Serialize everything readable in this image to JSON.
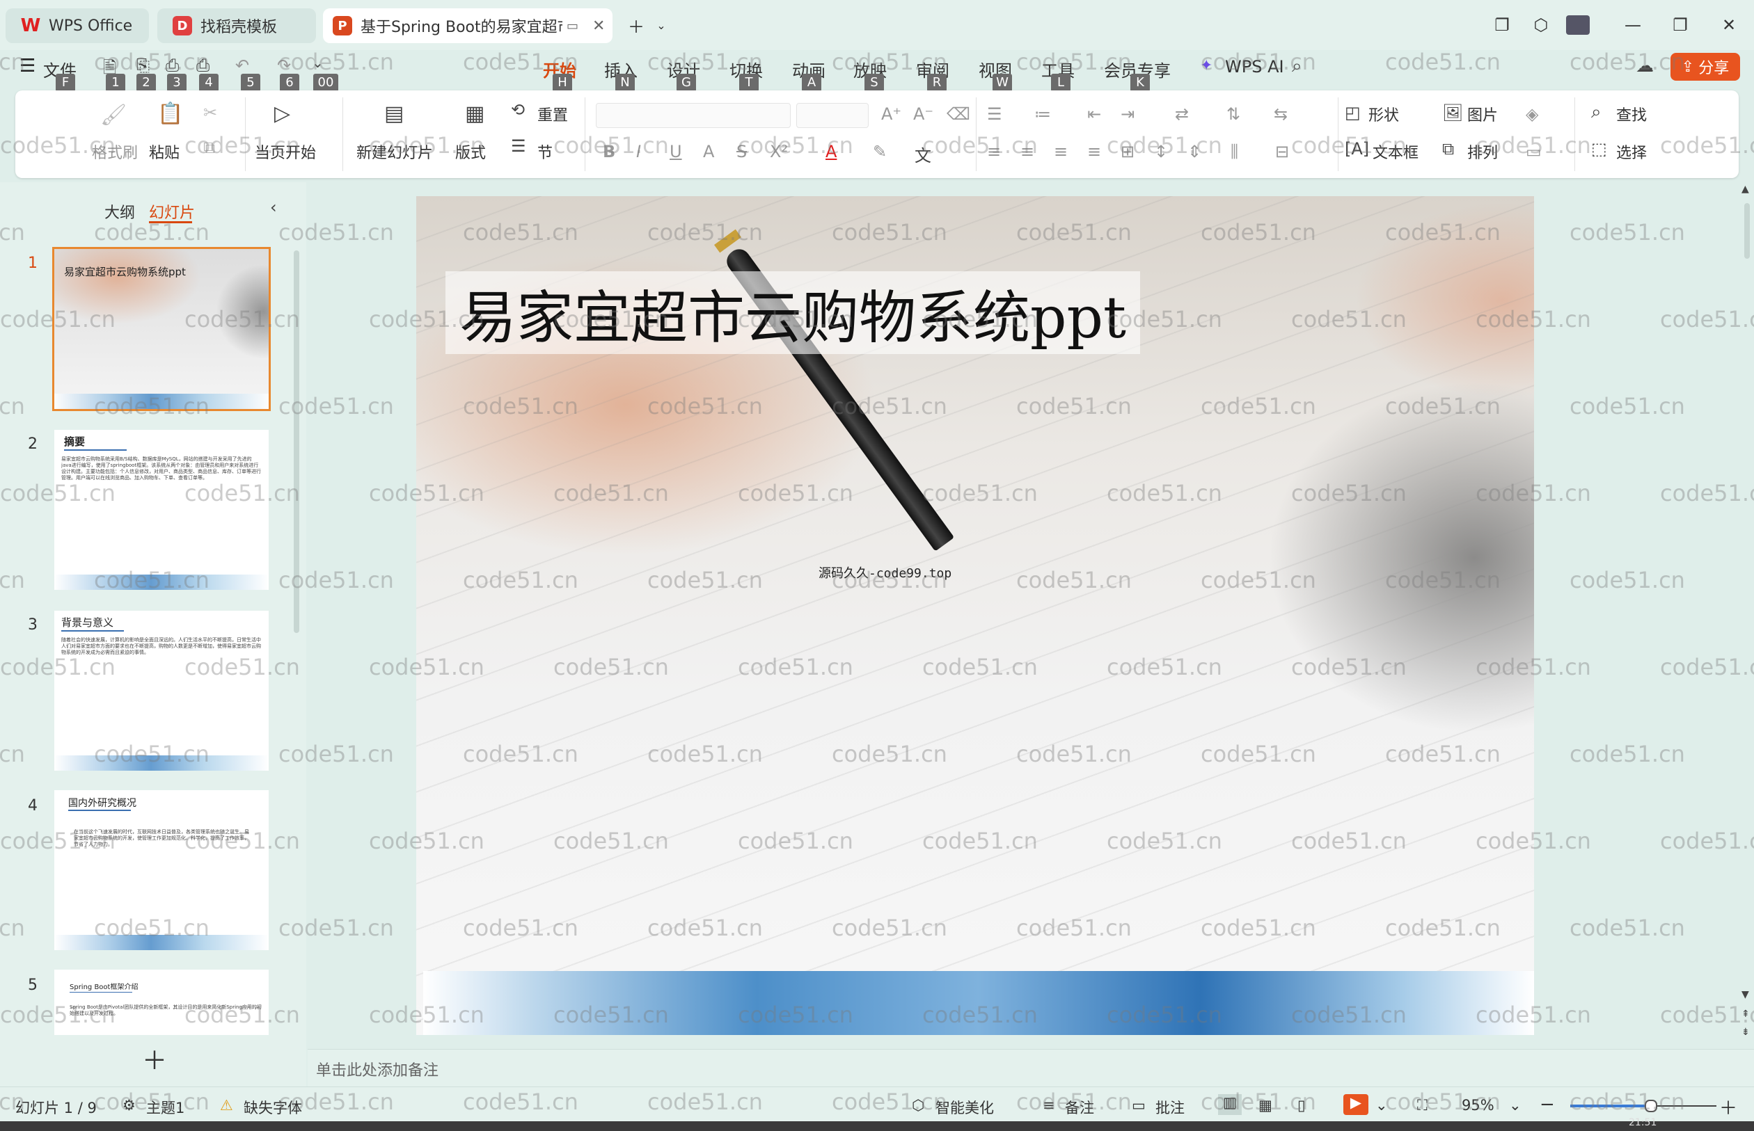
{
  "tabs": [
    {
      "label": "WPS Office"
    },
    {
      "label": "找稻壳模板"
    },
    {
      "label": "基于Spring Boot的易家宜超市"
    }
  ],
  "menus": [
    {
      "label": "文件",
      "hint": "F"
    },
    {
      "label": "开始",
      "hint": "H"
    },
    {
      "label": "插入",
      "hint": "N"
    },
    {
      "label": "设计",
      "hint": "G"
    },
    {
      "label": "切换",
      "hint": "T"
    },
    {
      "label": "动画",
      "hint": "A"
    },
    {
      "label": "放映",
      "hint": "S"
    },
    {
      "label": "审阅",
      "hint": "R"
    },
    {
      "label": "视图",
      "hint": "W"
    },
    {
      "label": "工具",
      "hint": "L"
    },
    {
      "label": "会员专享",
      "hint": "K"
    },
    {
      "label": "WPS AI"
    }
  ],
  "quick_hints": [
    "1",
    "2",
    "3",
    "4",
    "5",
    "6",
    "00"
  ],
  "share_label": "分享",
  "ribbon": {
    "format_brush": "格式刷",
    "paste": "粘贴",
    "from_current": "当页开始",
    "new_slide": "新建幻灯片",
    "layout": "版式",
    "reset": "重置",
    "section": "节",
    "shape": "形状",
    "picture": "图片",
    "find": "查找",
    "textbox": "文本框",
    "arrange": "排列",
    "select": "选择"
  },
  "left_panel": {
    "tab_outline": "大纲",
    "tab_slides": "幻灯片",
    "slides": [
      {
        "num": "1",
        "title": "易家宜超市云购物系统ppt"
      },
      {
        "num": "2",
        "title": "摘要",
        "body": "易家宜超市云购物系统采用B/S结构、数据库是MySQL，网站的搭建与开发采用了先进的java进行编写，使用了springboot框架。该系统从两个对象：由管理员和用户来对系统进行设计构建。主要功能包括：个人信息修改，对用户、商品类型、商品信息、库存、订单等进行管理。用户端可以在线浏览商品、加入购物车、下单、查看订单等。"
      },
      {
        "num": "3",
        "title": "背景与意义",
        "body": "随着社会的快速发展，计算机的影响是全面且深远的。人们生活水平的不断提高，日常生活中人们对易家宜超市方面的要求也在不断提高，购物的人数更是不断增加，使得易家宜超市云购物系统的开发成为必需而且紧迫的事情。"
      },
      {
        "num": "4",
        "title": "国内外研究概况",
        "body": "在当前这个飞速发展的时代，互联网技术日益普及，各类管理系统也随之诞生。易家宜超市云购物系统的开发，使管理工作更加规范化、科学化，提高了工作效率，节省了人力物力。"
      },
      {
        "num": "5",
        "title": "Spring Boot框架介绍",
        "body": "Spring Boot是由Pivotal团队提供的全新框架，其设计目的是用来简化新Spring应用的初始搭建以及开发过程。"
      }
    ]
  },
  "slide": {
    "title": "易家宜超市云购物系统ppt",
    "subtitle": "源码久久-code99.top"
  },
  "notes_placeholder": "单击此处添加备注",
  "status": {
    "slide_counter": "幻灯片 1 / 9",
    "theme": "主题1",
    "missing_font": "缺失字体",
    "smart_beautify": "智能美化",
    "notes": "备注",
    "comments": "批注",
    "zoom": "95%",
    "zoom_level": 0.55
  },
  "clock": "21:51",
  "watermark": "code51.cn"
}
